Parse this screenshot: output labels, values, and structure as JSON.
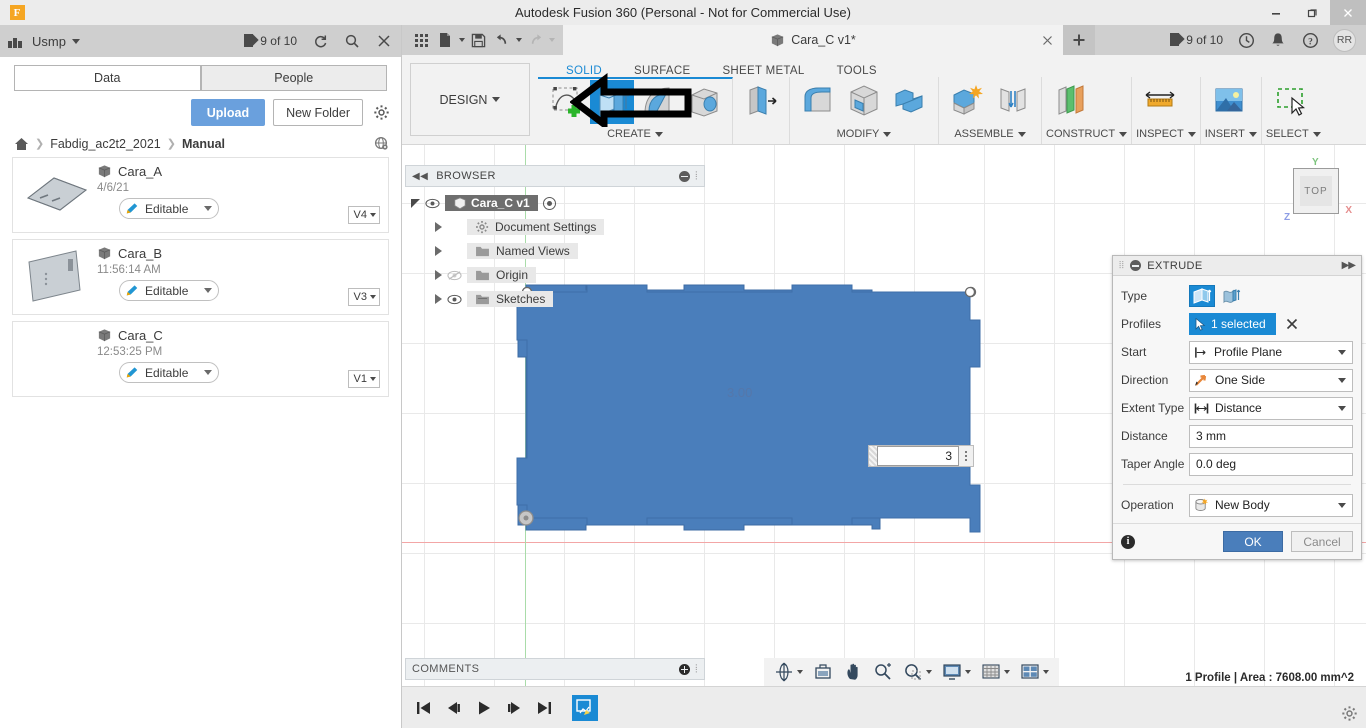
{
  "window": {
    "title": "Autodesk Fusion 360 (Personal - Not for Commercial Use)",
    "minimize": "–",
    "maximize": "❐",
    "close": "✕"
  },
  "data_panel": {
    "hub_name": "Usmp",
    "job_count": "9 of 10",
    "refresh_icon": "refresh-icon",
    "search_icon": "search-icon",
    "close_icon": "close-icon",
    "tabs": [
      {
        "label": "Data",
        "active": true
      },
      {
        "label": "People",
        "active": false
      }
    ],
    "upload_label": "Upload",
    "new_folder_label": "New Folder",
    "settings_icon": "gear-icon",
    "breadcrumb": {
      "home_icon": "home-icon",
      "items": [
        "Fabdig_ac2t2_2021",
        "Manual"
      ],
      "globe_icon": "globe-icon"
    },
    "files": [
      {
        "name": "Cara_A",
        "date": "4/6/21",
        "status": "Editable",
        "version": "V4"
      },
      {
        "name": "Cara_B",
        "date": "11:56:14 AM",
        "status": "Editable",
        "version": "V3"
      },
      {
        "name": "Cara_C",
        "date": "12:53:25 PM",
        "status": "Editable",
        "version": "V1"
      }
    ]
  },
  "tabstrip": {
    "quick_access": [
      "grid-apps-icon",
      "new-document-icon",
      "save-icon",
      "undo-icon",
      "redo-icon"
    ],
    "document_tab": "Cara_C v1*",
    "tab_close": "✕",
    "new_tab": "+",
    "job_count": "9 of 10",
    "history_icon": "clock-icon",
    "notification_icon": "bell-icon",
    "help_icon": "help-icon",
    "avatar_initials": "RR"
  },
  "ribbon": {
    "workspace_label": "DESIGN",
    "workspace_tabs": [
      {
        "label": "SOLID",
        "active": true
      },
      {
        "label": "SURFACE",
        "active": false
      },
      {
        "label": "SHEET METAL",
        "active": false
      },
      {
        "label": "TOOLS",
        "active": false
      }
    ],
    "panels": [
      {
        "label": "CREATE",
        "dropdown": true
      },
      {
        "label": "MODIFY",
        "dropdown": true
      },
      {
        "label": "ASSEMBLE",
        "dropdown": true
      },
      {
        "label": "CONSTRUCT",
        "dropdown": true
      },
      {
        "label": "INSPECT",
        "dropdown": true
      },
      {
        "label": "INSERT",
        "dropdown": true
      },
      {
        "label": "SELECT",
        "dropdown": true
      }
    ],
    "create_tools": [
      "create-sketch-icon",
      "extrude-icon",
      "revolve-icon",
      "sweep-icon"
    ],
    "selected_tool": "extrude-icon"
  },
  "browser": {
    "title": "BROWSER",
    "collapse_icon": "collapse-left-icon",
    "minimize_icon": "minimize-icon",
    "nodes": [
      {
        "label": "Cara_C v1",
        "selected": true,
        "visible": true,
        "depth": 0
      },
      {
        "label": "Document Settings",
        "selected": false,
        "visible": false,
        "depth": 1,
        "icon": "gear-icon"
      },
      {
        "label": "Named Views",
        "selected": false,
        "visible": false,
        "depth": 1,
        "icon": "folder-icon"
      },
      {
        "label": "Origin",
        "selected": false,
        "visible": false,
        "depth": 1,
        "icon": "folder-icon"
      },
      {
        "label": "Sketches",
        "selected": false,
        "visible": true,
        "depth": 1,
        "icon": "folder-sketch-icon"
      }
    ]
  },
  "canvas": {
    "dimension_label": "3.00",
    "edit_value": "3",
    "viewcube_face": "TOP",
    "axis_x": "X",
    "axis_y": "Y",
    "axis_z": "Z",
    "shape_fill": "#4a7ebb"
  },
  "dialog": {
    "title": "EXTRUDE",
    "expand_icon": "expand-right-icon",
    "minimize_icon": "minimize-icon",
    "rows": [
      {
        "label": "Type",
        "type": "segmented",
        "options": [
          "profile-extrude-icon",
          "surface-extrude-icon"
        ],
        "selected": 0
      },
      {
        "label": "Profiles",
        "type": "selection",
        "value": "1 selected",
        "clear": "✕"
      },
      {
        "label": "Start",
        "type": "combo",
        "value": "Profile Plane",
        "icon": "profile-plane-icon"
      },
      {
        "label": "Direction",
        "type": "combo",
        "value": "One Side",
        "icon": "one-side-icon"
      },
      {
        "label": "Extent Type",
        "type": "combo",
        "value": "Distance",
        "icon": "distance-icon"
      },
      {
        "label": "Distance",
        "type": "text",
        "value": "3 mm"
      },
      {
        "label": "Taper Angle",
        "type": "text",
        "value": "0.0 deg"
      },
      {
        "label": "Operation",
        "type": "combo",
        "value": "New Body",
        "icon": "new-body-icon"
      }
    ],
    "info_icon": "info-icon",
    "ok_label": "OK",
    "cancel_label": "Cancel"
  },
  "footer": {
    "comments_label": "COMMENTS",
    "add_comment_icon": "add-icon",
    "navbar_icons": [
      "orbit-icon",
      "look-at-icon",
      "pan-icon",
      "zoom-icon",
      "zoom-window-icon",
      "display-settings-icon",
      "grid-snaps-icon",
      "viewports-icon"
    ],
    "status_text": "1 Profile | Area : 7608.00 mm^2",
    "timeline_icons": [
      "skip-to-start-icon",
      "step-back-icon",
      "play-icon",
      "step-forward-icon",
      "skip-to-end-icon"
    ],
    "timeline_feature": "sketch-feature-icon",
    "settings_icon": "gear-icon"
  },
  "annotation": {
    "arrow": "left-pointing-arrow",
    "target": "extrude-icon"
  }
}
